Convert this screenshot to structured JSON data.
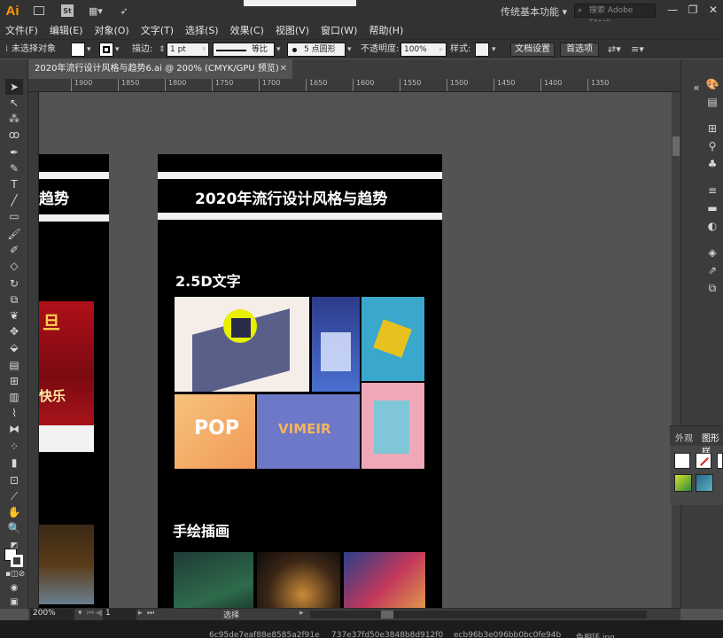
{
  "titlebar": {
    "logo": "Ai",
    "st_label": "St",
    "workspace": "传统基本功能",
    "search_placeholder": "搜索 Adobe Stock",
    "minimize": "—",
    "restore": "❐",
    "close": "✕"
  },
  "menu": [
    "文件(F)",
    "编辑(E)",
    "对象(O)",
    "文字(T)",
    "选择(S)",
    "效果(C)",
    "视图(V)",
    "窗口(W)",
    "帮助(H)"
  ],
  "control": {
    "no_selection": "未选择对象",
    "stroke_label": "描边:",
    "stroke_value": "1 pt",
    "stroke_style": "等比",
    "brush_value": "5 点圆形",
    "opacity_label": "不透明度:",
    "opacity_value": "100%",
    "style_label": "样式:",
    "doc_setup": "文档设置",
    "preferences": "首选项"
  },
  "document": {
    "tab_title": "2020年流行设计风格与趋势6.ai @ 200% (CMYK/GPU 预览)",
    "close": "✕"
  },
  "ruler": {
    "ticks": [
      "1900",
      "1850",
      "1800",
      "1750",
      "1700",
      "1650",
      "1600",
      "1550",
      "1500",
      "1450",
      "1400",
      "1350"
    ]
  },
  "artboard_main": {
    "title": "2020年流行设计风格与趋势",
    "section1": "2.5D文字",
    "section2": "手绘插画",
    "thumb_pop": "POP",
    "thumb_vimeir": "VIMEIR"
  },
  "artboard_left": {
    "title_fragment": "趋势",
    "red_text1": "旦",
    "red_text2": "快乐"
  },
  "panel": {
    "tab_appearance": "外观",
    "tab_graphic_styles": "图形样"
  },
  "status": {
    "zoom": "200%",
    "page": "1",
    "mode": "选择"
  },
  "taskbar": {
    "item1": "6c95de7eaf88e8585a2f91e",
    "item2": "737e37fd50e3848b8d912f0",
    "item3": "ecb96b3e096bb0bc0fe94b",
    "item4": "色相环.jpg"
  }
}
